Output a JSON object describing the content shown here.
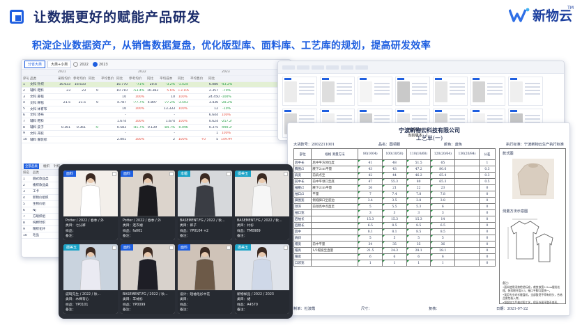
{
  "header": {
    "title": "让数据更好的赋能产品研发",
    "subtitle": "积淀企业数据资产，从销售数据复盘，优化版型库、面料库、工艺库的规划，提高研发效率",
    "logo_text": "新物云",
    "logo_tm": "TM"
  },
  "colors": {
    "accent": "#1f5fe0",
    "title": "#1c2d6b",
    "positive": "#e34a3c",
    "negative": "#1b9a3e"
  },
  "sales": {
    "tabs": [
      "分省大类",
      "大类+小类"
    ],
    "years": [
      "2022",
      "2023"
    ],
    "selected_year": "2023",
    "col_years": [
      "2021",
      "2022",
      "2023"
    ],
    "header": [
      "序号",
      "品类",
      "采购均价",
      "参考均价",
      "同比",
      "平均售价",
      "同比",
      "参考均价",
      "同比",
      "平均成本",
      "同比",
      "平均售价",
      "同比"
    ],
    "rows": [
      {
        "no": "1",
        "cat": "文科 针织",
        "c": [
          "16.633",
          "16.633",
          "",
          "",
          "16.770",
          "-71%",
          "20.6",
          "-3.2%",
          "-1.424",
          "",
          "6.080",
          "-43.2%"
        ],
        "hl": true
      },
      {
        "no": "2",
        "cat": "辅料 鞋料",
        "c": [
          "23",
          "23",
          "0",
          "",
          "10.710",
          "-53.4%",
          "10.383",
          "5.6%",
          "+3.109",
          "",
          "2.357",
          "-70%"
        ]
      },
      {
        "no": "3",
        "cat": "文科 鼻毯",
        "c": [
          "",
          "",
          "",
          "",
          "10",
          "100%",
          "",
          "10",
          "100%",
          "",
          "24.450",
          "-100%"
        ]
      },
      {
        "no": "4",
        "cat": "文科 棉毯",
        "c": [
          "21.5",
          "21.5",
          "0",
          "",
          "4.787",
          "-77.7%",
          "4.897",
          "-77.2%",
          "-3.503",
          "",
          "3.436",
          "-28.2%"
        ]
      },
      {
        "no": "5",
        "cat": "文科 体育布",
        "c": [
          "",
          "",
          "",
          "",
          "10",
          "100%",
          "",
          "13.333",
          "100%",
          "",
          "12",
          "-10%"
        ]
      },
      {
        "no": "6",
        "cat": "文科 坯布",
        "c": [
          "",
          "",
          "",
          "",
          "-",
          "",
          "",
          "-",
          "",
          "",
          "6.644",
          "100%"
        ]
      },
      {
        "no": "7",
        "cat": "辅料 鞋料",
        "c": [
          "",
          "",
          "",
          "",
          "1.674",
          "100%",
          "",
          "1.674",
          "100%",
          "",
          "0.624",
          "-257.2%"
        ]
      },
      {
        "no": "8",
        "cat": "辅料 皮子",
        "c": [
          "0.361",
          "0.361",
          "-0",
          "",
          "0.583",
          "-81.7%",
          "0.139",
          "-84.7%",
          "-0.096",
          "",
          "0.375",
          "-990.2%"
        ]
      },
      {
        "no": "9",
        "cat": "文科 开胶",
        "c": [
          "",
          "",
          "",
          "",
          "-",
          "",
          "",
          "-",
          "",
          "",
          "1",
          "100%"
        ]
      },
      {
        "no": "10",
        "cat": "辅料 服装标",
        "c": [
          "",
          "",
          "",
          "",
          "2.001",
          "100%",
          "",
          "2",
          "100%",
          "+0",
          "5",
          "149.9%"
        ]
      }
    ],
    "bottom_tabs": [
      "全部品类",
      "梭织",
      "针织",
      "毛织",
      "鞋类",
      "服装",
      "配饰",
      "毛线",
      "版型",
      "面料",
      "工艺"
    ],
    "list_header": [
      "排名",
      "品类"
    ],
    "list": [
      {
        "no": "1",
        "name": "圆式款品类"
      },
      {
        "no": "2",
        "name": "梭织款品类"
      },
      {
        "no": "3",
        "name": "工卡"
      },
      {
        "no": "4",
        "name": "新物价组织"
      },
      {
        "no": "5",
        "name": "生物价组"
      },
      {
        "no": "6",
        "name": "NJ"
      },
      {
        "no": "7",
        "name": "方眼织组"
      },
      {
        "no": "8",
        "name": "纯棉针织"
      },
      {
        "no": "9",
        "name": "精织化纤"
      },
      {
        "no": "10",
        "name": "毛品"
      }
    ]
  },
  "order": {
    "company": "宁波新物云科技有限公司",
    "doc_title": "工艺单(一)",
    "meta_left": "当前版本：",
    "meta_left_val": "1",
    "meta_left2": "当前版本：",
    "meta_left2_val": "1",
    "fields": [
      {
        "label": "大货款号：",
        "value": "2002211001"
      },
      {
        "label": "品名：",
        "value": "圆领服"
      },
      {
        "label": "颜色：",
        "value": "蓝色"
      },
      {
        "label": "执行标准：",
        "value": "宁波新物云生产执行标准"
      }
    ],
    "table_head": [
      "部位",
      "规格  测量方法",
      "80(1004)",
      "100(10/50)",
      "110(10/60)",
      "120(20/64)",
      "130(20/84)",
      "公差"
    ],
    "rows": [
      {
        "part": "后中长",
        "method": "后中平方领位度",
        "v": [
          "41",
          "48",
          "51.5",
          "65",
          "",
          "1"
        ]
      },
      {
        "part": "胸围/2",
        "method": "腋下2cm平量",
        "v": [
          "43",
          "43",
          "47.2",
          "80.6",
          "",
          "0.3"
        ]
      },
      {
        "part": "肩宽",
        "method": "前肩点至",
        "v": [
          "42",
          "44",
          "46.2",
          "65.4",
          "",
          "0.3"
        ]
      },
      {
        "part": "前中长",
        "method": "前中平领口至底",
        "v": [
          "47",
          "55.3",
          "80",
          "65.3",
          "",
          "0.5"
        ]
      },
      {
        "part": "袖肥/2",
        "method": "腋下2cm平量",
        "v": [
          "26",
          "21",
          "22",
          "23",
          "",
          "0"
        ]
      },
      {
        "part": "袖口/2",
        "method": "平量",
        "v": [
          "7",
          "7.4",
          "7.8",
          "7.8",
          "",
          "0"
        ]
      },
      {
        "part": "脚围宽",
        "method": "侧缝脚口至底边",
        "v": [
          "3.4",
          "3.5",
          "3.8",
          "3.8",
          "",
          "0"
        ]
      },
      {
        "part": "领深",
        "method": "前领高中点直至",
        "v": [
          "5",
          "5.5",
          "5.3",
          "6",
          "",
          "0"
        ]
      },
      {
        "part": "袖口宽",
        "method": "",
        "v": [
          "3",
          "3",
          "3",
          "3",
          "",
          "0"
        ]
      },
      {
        "part": "后袖长",
        "method": "",
        "v": [
          "15.3",
          "15.3",
          "15.3",
          "14",
          "",
          "0"
        ]
      },
      {
        "part": "后腰长",
        "method": "",
        "v": [
          "6.5",
          "8.5",
          "8.5",
          "6.5",
          "",
          "0"
        ]
      },
      {
        "part": "后中",
        "method": "",
        "v": [
          "8.1",
          "8.1",
          "8.5",
          "8.5",
          "",
          "0"
        ]
      },
      {
        "part": "肩斜",
        "method": "",
        "v": [
          "5",
          "5",
          "5",
          "5",
          "",
          "0"
        ]
      },
      {
        "part": "帽宽",
        "method": "前中平量",
        "v": [
          "34",
          "35",
          "35",
          "36",
          "",
          "0"
        ]
      },
      {
        "part": "帽高",
        "method": "1/2帽宽至直量",
        "v": [
          "21.5",
          "24.3",
          "28.1",
          "28.1",
          "",
          "0"
        ]
      },
      {
        "part": "帽宽",
        "method": "",
        "v": [
          "6",
          "6",
          "6",
          "6",
          "",
          "0"
        ]
      },
      {
        "part": "口袋宽",
        "method": "",
        "v": [
          "1",
          "1",
          "1",
          "1",
          "",
          "0"
        ]
      }
    ],
    "side_title": "款式图",
    "side_sketch_title": "测量方法示意图",
    "notes": "备注：\n•面料使用须按检验标准，裁剪放宽2.5cm缝份处理，装扣眼开度0.5，袖口平脚口要统一。\n•采用专业毛衫缝盘机，全部整烫不得有线头，合格品需包装入库。\n•领部加工严格对照工艺，保证外观平整不变形。",
    "footer": [
      {
        "label": "制单：",
        "value": "杜波霞"
      },
      {
        "label": "尺寸：",
        "value": ""
      },
      {
        "label": "复核：",
        "value": ""
      },
      {
        "label": "日期：",
        "value": "2021-07-22"
      }
    ]
  },
  "photos": [
    {
      "tag": "面料",
      "tag_color": "#1f5fe0",
      "line1": "Potter / 2022 / 春季 / 外",
      "line2": "类目：七分裤",
      "line3": "样品：",
      "line4": "备注："
    },
    {
      "tag": "面料",
      "tag_color": "#1f5fe0",
      "line1": "Potter / 2022 / 春季 / 外",
      "line2": "类目：连衣裙",
      "line3": "样品：fa001",
      "line4": "备注："
    },
    {
      "tag": "本櫃",
      "tag_color": "#1aa3c7",
      "line1": "BASEMENT.FG / 2022 / 秋...",
      "line2": "类目：裤子",
      "line3": "样品：YP0104 +2",
      "line4": "备注："
    },
    {
      "tag": "摄美玉",
      "tag_color": "#1aa3c7",
      "line1": "BASEMENT.FG / 2022 / 秋...",
      "line2": "类目：衬衫",
      "line3": "样品：TM0989",
      "line4": "备注："
    },
    {
      "tag": "摄美玉",
      "tag_color": "#1aa3c7",
      "line1": "戚琦先生 / 2022 / 秋...",
      "line2": "类目：木棉背心",
      "line3": "样品：YP0101",
      "line4": "备注："
    },
    {
      "tag": "面料",
      "tag_color": "#1f5fe0",
      "line1": "BASEMENT.FG / 2022 / 秋...",
      "line2": "类目：羊绒衫",
      "line3": "样品：YP0099",
      "line4": "备注："
    },
    {
      "tag": "面料",
      "tag_color": "#1f5fe0",
      "line1": "设计：短袖毛衫中花",
      "line2": "类目：",
      "line3": "样品：",
      "line4": "备注："
    },
    {
      "tag": "摄美玉",
      "tag_color": "#1aa3c7",
      "line1": "新物样品 / 2022 / 2023",
      "line2": "类目：裙",
      "line3": "样品：A4570",
      "line4": "备注："
    }
  ]
}
